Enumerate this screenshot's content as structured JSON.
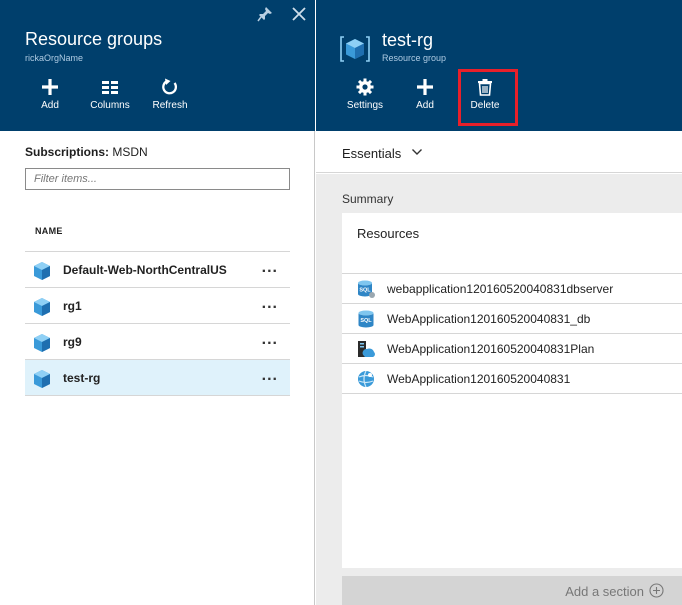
{
  "left_blade": {
    "title": "Resource groups",
    "subtitle": "rickaOrgName",
    "commands": [
      {
        "label": "Add",
        "icon": "plus-icon"
      },
      {
        "label": "Columns",
        "icon": "columns-icon"
      },
      {
        "label": "Refresh",
        "icon": "refresh-icon"
      }
    ],
    "subscriptions_label": "Subscriptions:",
    "subscriptions_value": "MSDN",
    "filter_placeholder": "Filter items...",
    "column_header": "NAME",
    "rows": [
      {
        "name": "Default-Web-NorthCentralUS",
        "more": "...",
        "selected": false
      },
      {
        "name": "rg1",
        "more": "...",
        "selected": false
      },
      {
        "name": "rg9",
        "more": "...",
        "selected": false
      },
      {
        "name": "test-rg",
        "more": "...",
        "selected": true
      }
    ]
  },
  "right_blade": {
    "title": "test-rg",
    "subtitle": "Resource group",
    "commands": [
      {
        "label": "Settings",
        "icon": "gear-icon"
      },
      {
        "label": "Add",
        "icon": "plus-icon"
      },
      {
        "label": "Delete",
        "icon": "trash-icon"
      }
    ],
    "essentials_label": "Essentials",
    "summary_label": "Summary",
    "resources_title": "Resources",
    "resources": [
      {
        "name": "webapplication120160520040831dbserver",
        "icon": "sql-server-icon"
      },
      {
        "name": "WebApplication120160520040831_db",
        "icon": "sql-database-icon"
      },
      {
        "name": "WebApplication120160520040831Plan",
        "icon": "app-service-plan-icon"
      },
      {
        "name": "WebApplication120160520040831",
        "icon": "web-app-icon"
      }
    ],
    "add_section_label": "Add a section"
  },
  "colors": {
    "header_bg": "#003f6c",
    "selected_row_bg": "#dff2fb",
    "highlight_border": "#e8202a",
    "lower_bg": "#ececec"
  }
}
